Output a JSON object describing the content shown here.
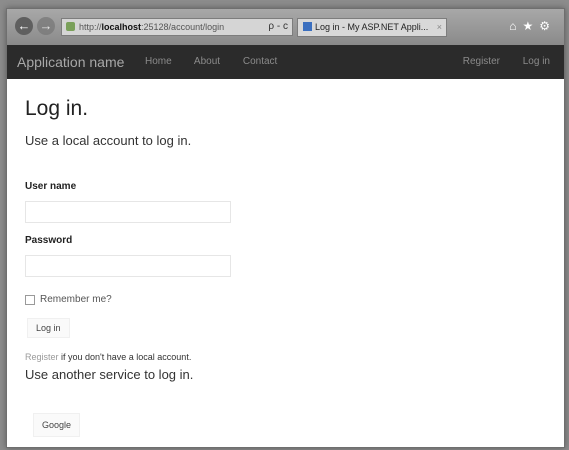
{
  "browser": {
    "url_prefix": "http://",
    "url_host": "localhost",
    "url_path": ":25128/account/login",
    "address_tools": "ρ - c",
    "tab_title": "Log in - My ASP.NET Appli...",
    "tab_close": "×",
    "toolbar_icons": "⌂★⚙"
  },
  "navbar": {
    "brand": "Application name",
    "links": [
      "Home",
      "About",
      "Contact"
    ],
    "register": "Register",
    "login": "Log in"
  },
  "page": {
    "title": "Log in.",
    "subtitle": "Use a local account to log in.",
    "username_label": "User name",
    "username_value": "",
    "password_label": "Password",
    "password_value": "",
    "remember_label": "Remember me?",
    "login_button": "Log in",
    "register_link": "Register",
    "register_suffix": " if you don't have a local account.",
    "other_service_heading": "Use another service to log in.",
    "google_button": "Google"
  }
}
